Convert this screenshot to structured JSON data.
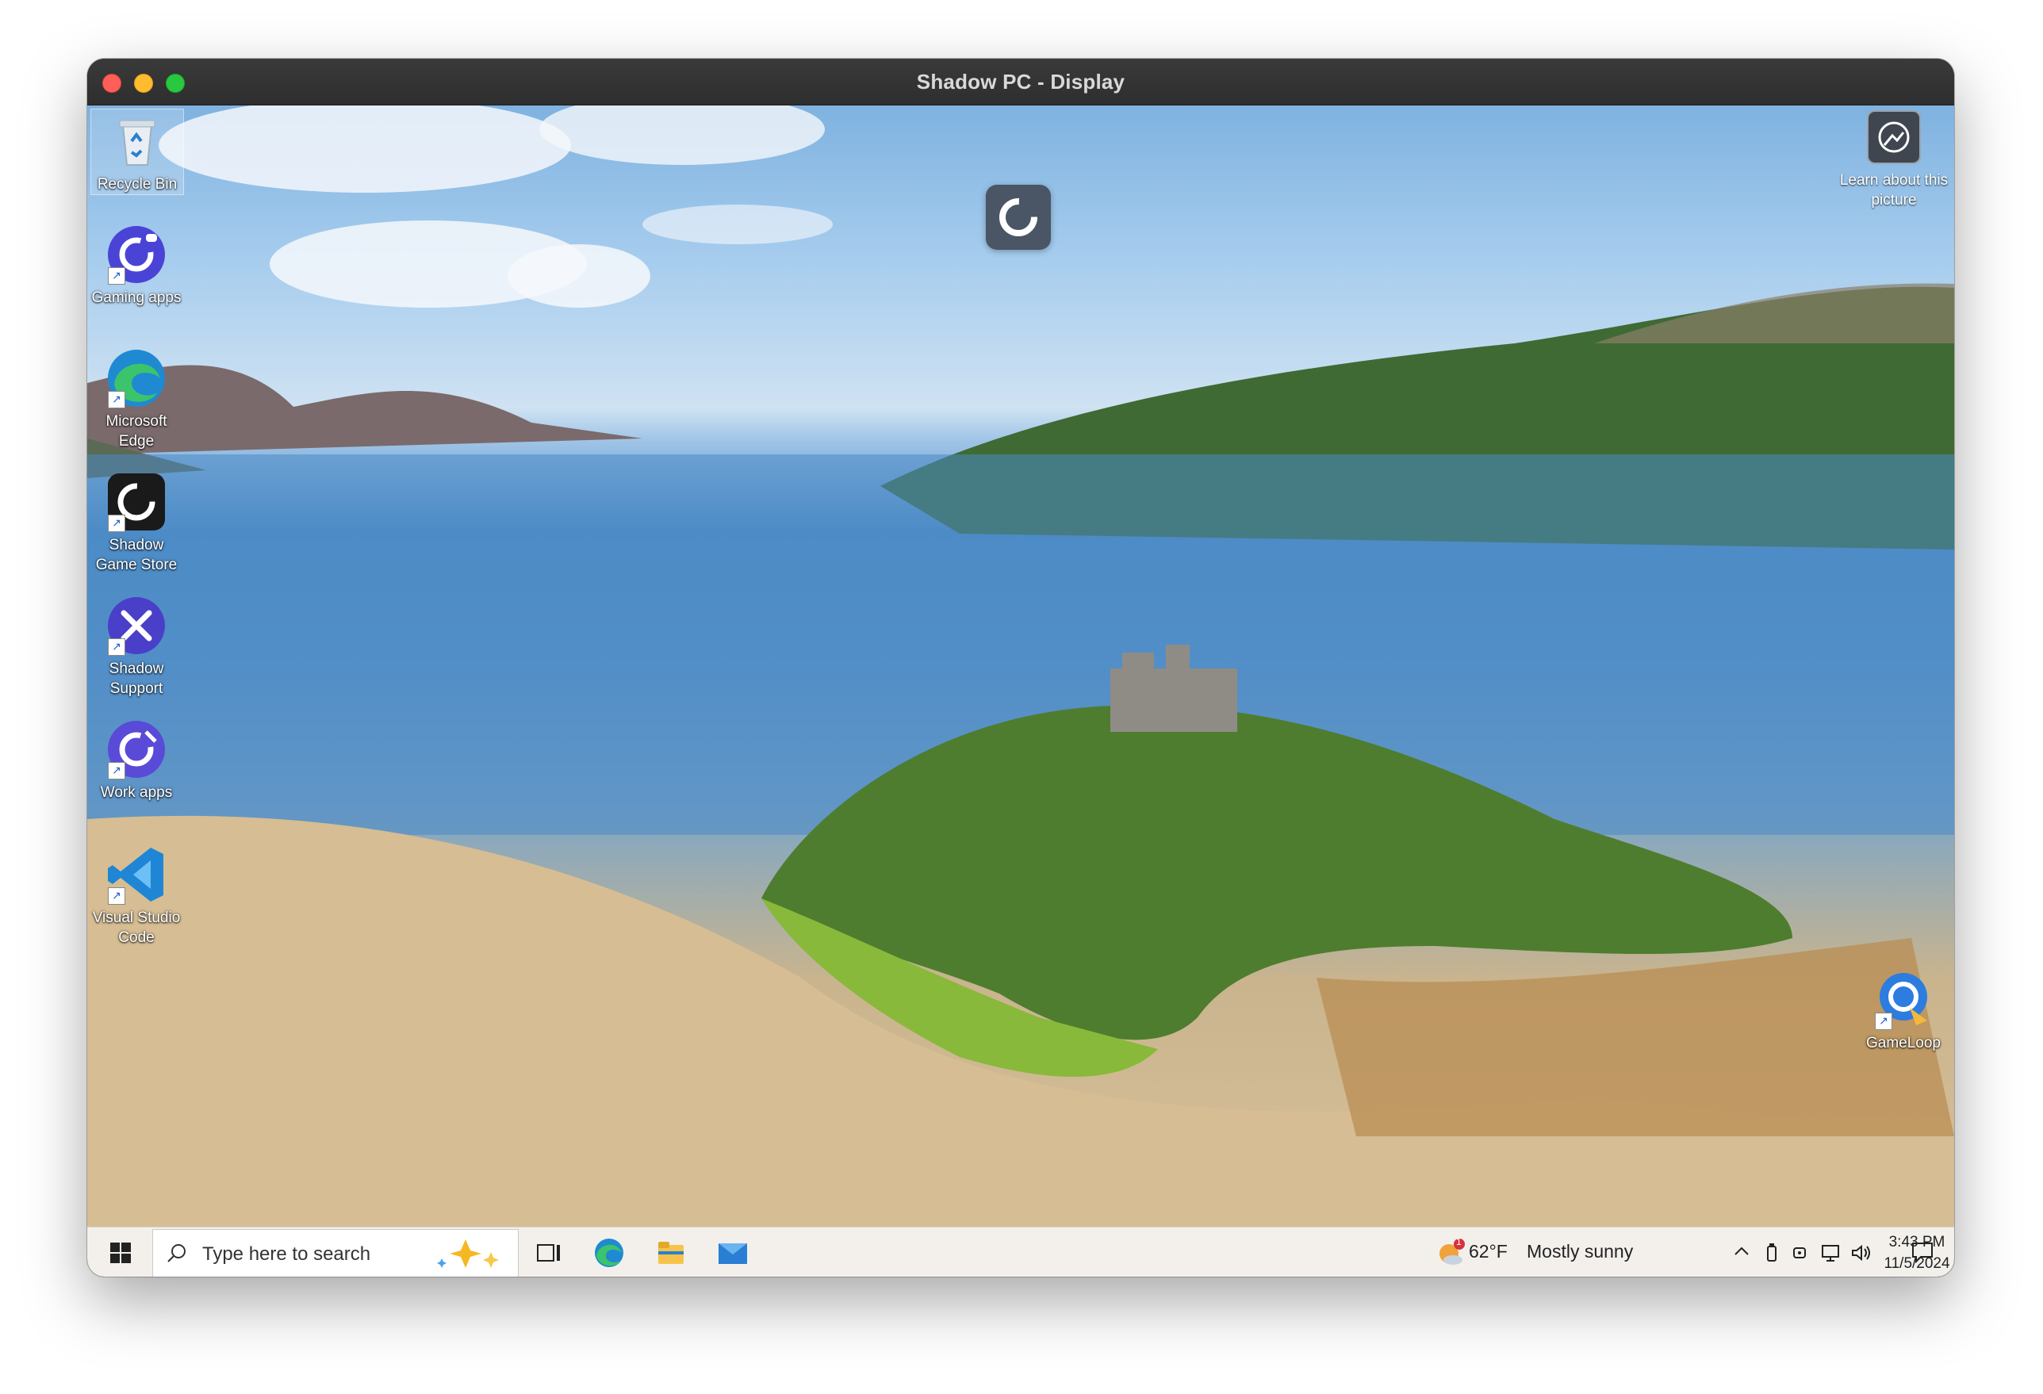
{
  "window": {
    "title": "Shadow PC - Display"
  },
  "desktop": {
    "icons": [
      {
        "label": "Recycle Bin",
        "icon": "recycle-bin-icon"
      },
      {
        "label": "Gaming apps",
        "icon": "gaming-apps-icon"
      },
      {
        "label": "Microsoft Edge",
        "icon": "edge-icon"
      },
      {
        "label": "Shadow Game Store",
        "icon": "shadow-game-store-icon"
      },
      {
        "label": "Shadow Support",
        "icon": "shadow-support-icon"
      },
      {
        "label": "Work apps",
        "icon": "work-apps-icon"
      },
      {
        "label": "Visual Studio Code",
        "icon": "vscode-icon"
      },
      {
        "label": "GameLoop",
        "icon": "gameloop-icon"
      }
    ],
    "learn_picture": "Learn about this picture"
  },
  "taskbar": {
    "search_placeholder": "Type here to search",
    "pinned": [
      "task-view-icon",
      "edge-icon",
      "file-explorer-icon",
      "mail-icon"
    ],
    "weather_temp": "62°F",
    "weather_desc": "Mostly sunny",
    "weather_badge": "1",
    "time": "3:43 PM",
    "date": "11/5/2024"
  },
  "colors": {
    "titlebar": "#2e2e2e",
    "taskbar": "#f3f0ec",
    "accent": "#0078d4"
  }
}
